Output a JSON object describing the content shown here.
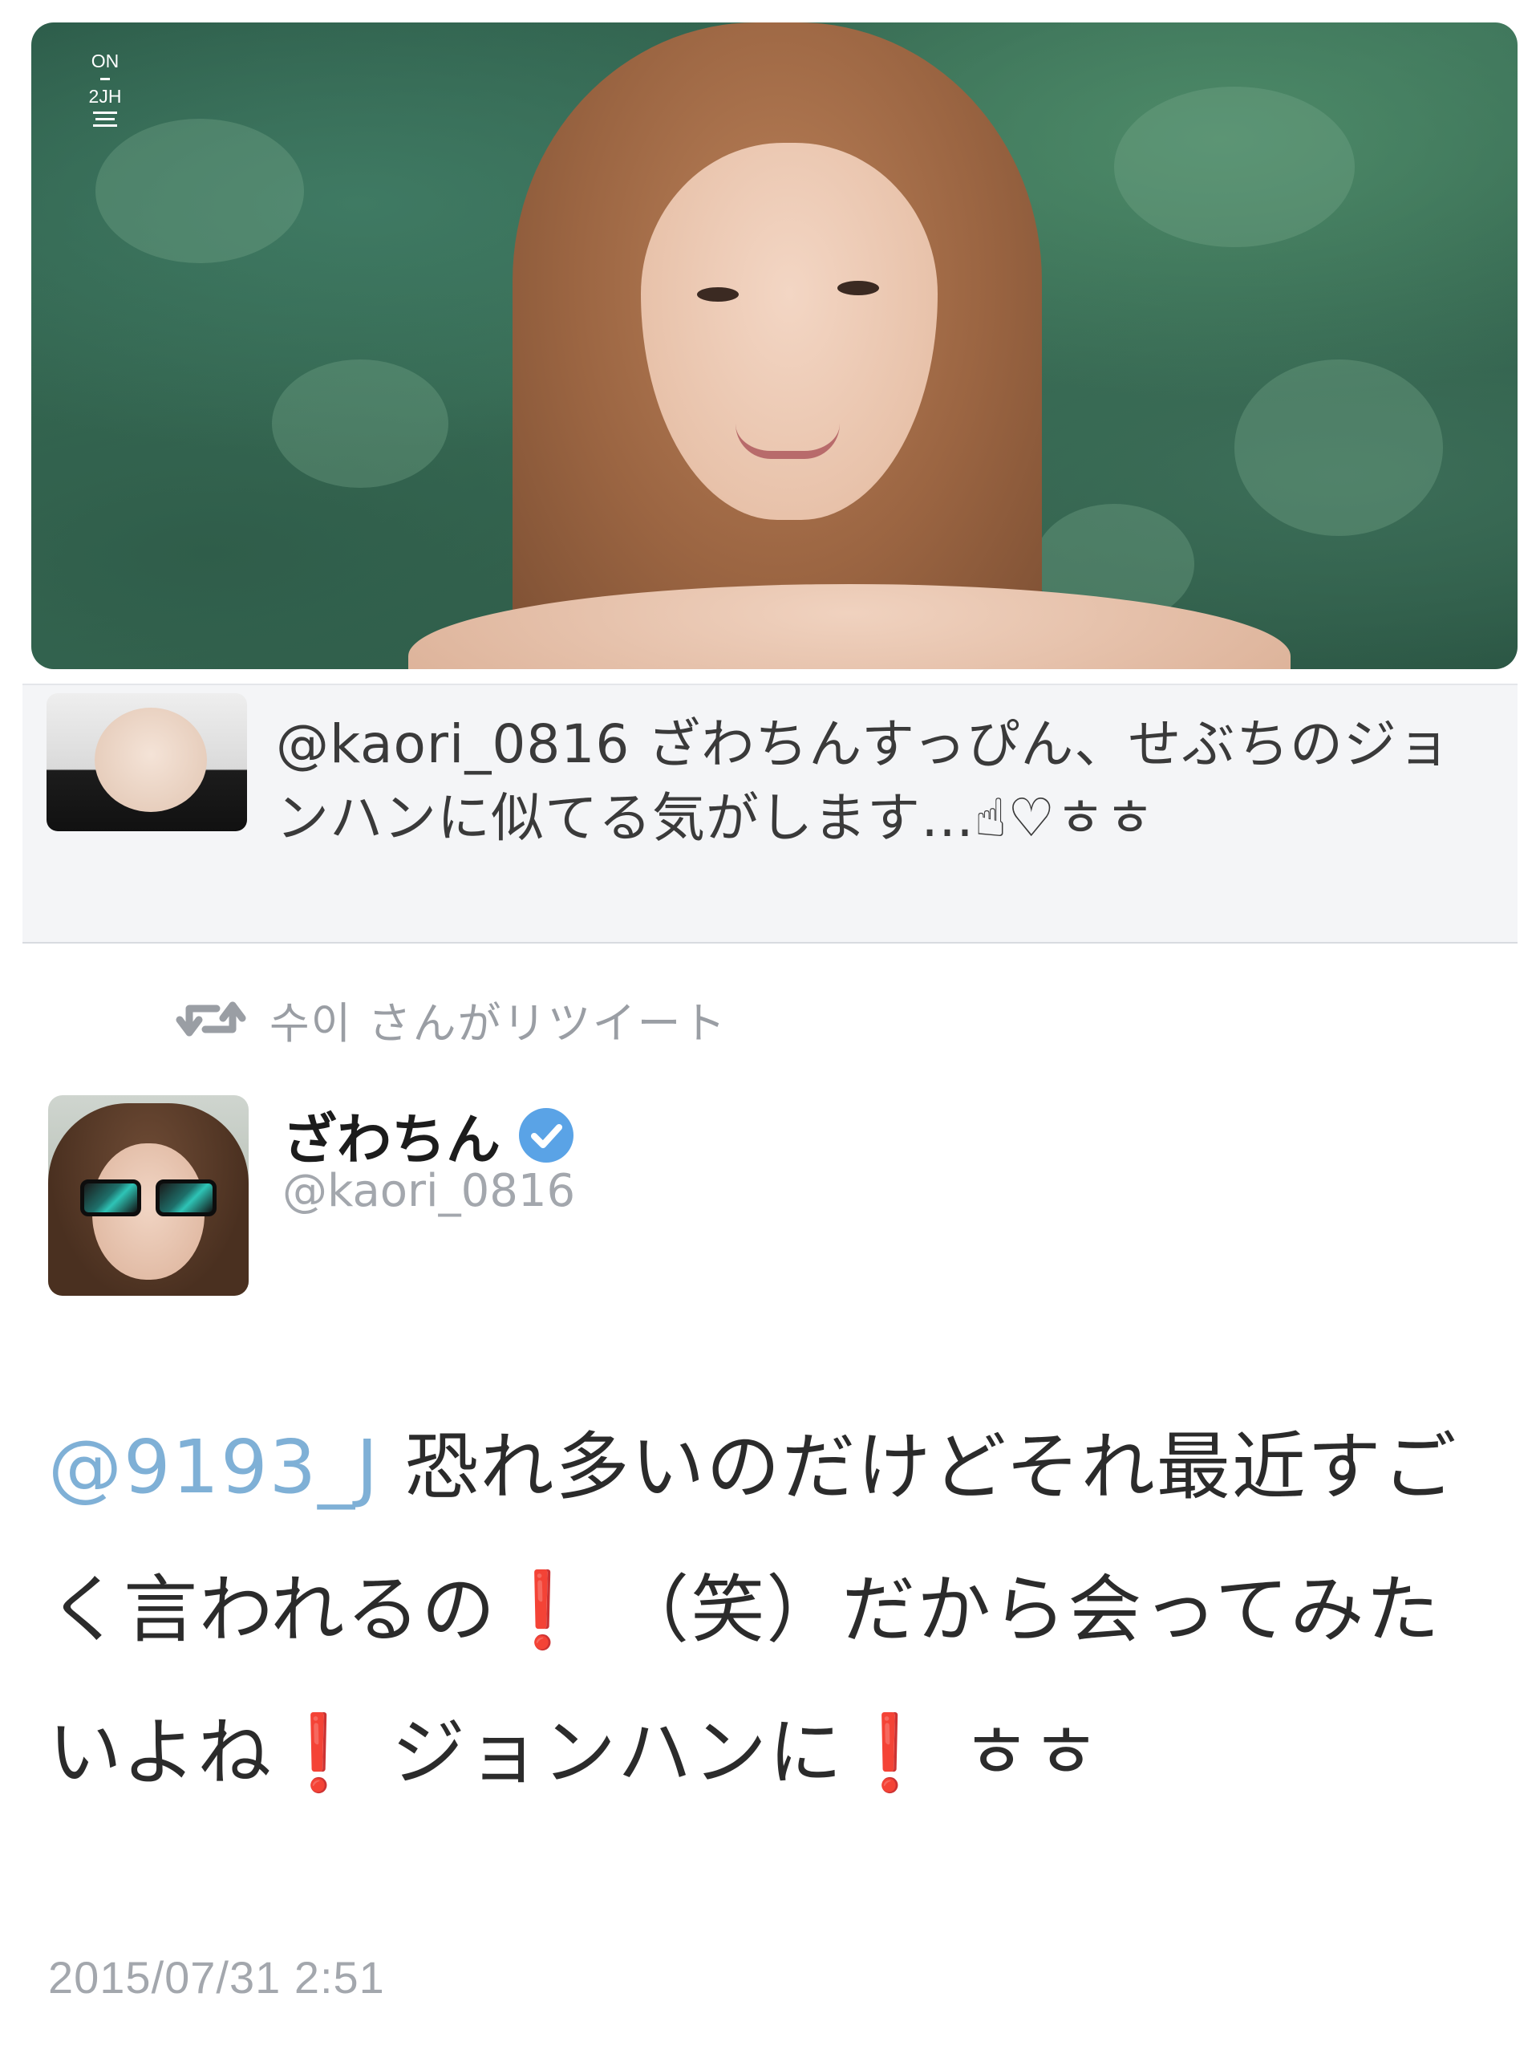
{
  "photo": {
    "overlay_top": "ON",
    "overlay_bottom": "2JH"
  },
  "quoted_tweet": {
    "text": "@kaori_0816 ざわちんすっぴん、せぶちのジョンハンに似てる気がします…☝♡ㅎㅎ"
  },
  "retweet_context": {
    "icon": "retweet-icon",
    "text": "수이 さんがリツイート"
  },
  "author": {
    "display_name": "ざわちん",
    "verified_icon": "verified-badge-icon",
    "handle": "@kaori_0816"
  },
  "tweet": {
    "mention": "@9193_J",
    "part1": " 恐れ多いのだけどそれ最近すごく言われるの",
    "excl1": "❗",
    "part2": " （笑）だから会ってみたいよね",
    "excl2": "❗",
    "part3": " ジョンハンに",
    "excl3": "❗",
    "part4": " ㅎㅎ"
  },
  "timestamp": "2015/07/31 2:51",
  "colors": {
    "mention": "#7fb0d6",
    "verified": "#5aa3e6",
    "exclamation": "#d7211f",
    "muted": "#a3a7ad"
  }
}
